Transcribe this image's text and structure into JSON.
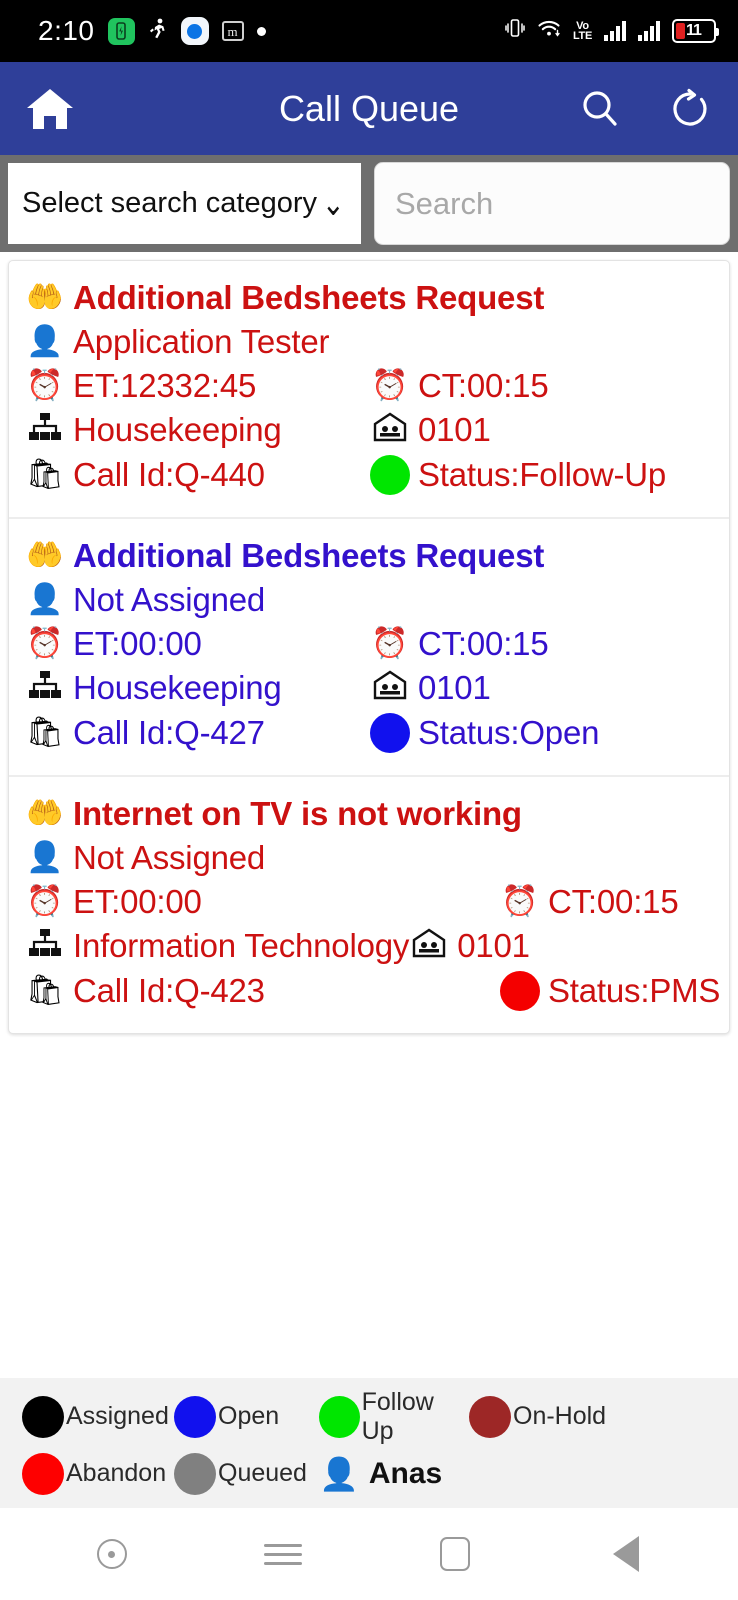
{
  "status_bar": {
    "time": "2:10",
    "left_icons": [
      "battery-saver-icon",
      "running-person-icon",
      "eye-app-icon",
      "m-app-icon",
      "notification-dot-icon"
    ],
    "m_glyph": "m",
    "right_icons": [
      "vibrate-icon",
      "wifi-icon",
      "volte-icon",
      "signal-sim1-icon",
      "signal-sim2-icon",
      "battery-icon"
    ],
    "vibrate_glyph": "❴▯❵",
    "wifi_glyph": "≋",
    "volte_line1": "Vo",
    "volte_line2": "LTE",
    "battery_level": "11",
    "battery_saver_glyph": "🗲"
  },
  "appbar": {
    "home_label": "home-icon",
    "title": "Call Queue",
    "search_label": "search-icon",
    "refresh_label": "refresh-icon"
  },
  "search": {
    "category_label": "Select search category",
    "category_chevron": "⌄",
    "search_placeholder": "Search"
  },
  "labels": {
    "et_prefix": "ET: ",
    "ct_prefix": "CT: ",
    "callid_prefix": "Call Id: ",
    "status_prefix": "Status: "
  },
  "icons": {
    "request": "🤲",
    "person": "👤",
    "clock": "⏰",
    "department": "🏢",
    "room": "🏩",
    "porter": "🛍"
  },
  "colors": {
    "appbar": "#2f3f99",
    "search_bar_bg": "#6e6e6e",
    "card_red": "#cc1111",
    "card_blue": "#3311cc",
    "status_green": "#00e600",
    "status_blue": "#1111ee",
    "status_red": "#f40000",
    "legend_black": "#000000",
    "legend_blue": "#1111ee",
    "legend_green": "#00e600",
    "legend_onhold": "#9d2726",
    "legend_abandon": "#fe0000",
    "legend_queued": "#808080"
  },
  "cards": [
    {
      "title": "Additional Bedsheets Request",
      "assignee": "Application Tester",
      "et": "12332:45",
      "ct": "00:15",
      "department": "Housekeeping",
      "room": "0101",
      "call_id": "Q-440",
      "status": "Follow-Up",
      "text_color": "#cc1111",
      "status_color": "#00e600",
      "wide_left": false
    },
    {
      "title": "Additional Bedsheets Request",
      "assignee": "Not Assigned",
      "et": "00:00",
      "ct": "00:15",
      "department": "Housekeeping",
      "room": "0101",
      "call_id": "Q-427",
      "status": "Open",
      "text_color": "#3311cc",
      "status_color": "#1111ee",
      "wide_left": false
    },
    {
      "title": "Internet on TV is not working",
      "assignee": "Not Assigned",
      "et": "00:00",
      "ct": "00:15",
      "department": "Information Technology",
      "room": "0101",
      "call_id": "Q-423",
      "status": "PMS",
      "text_color": "#cc1111",
      "status_color": "#f40000",
      "wide_left": true
    }
  ],
  "legend": {
    "row1": [
      {
        "label": "Assigned",
        "color": "#000000"
      },
      {
        "label": "Open",
        "color": "#1111ee"
      },
      {
        "label": "Follow Up",
        "color": "#00e600"
      },
      {
        "label": "On-Hold",
        "color": "#9d2726"
      }
    ],
    "row2": [
      {
        "label": "Abandon",
        "color": "#fe0000"
      },
      {
        "label": "Queued",
        "color": "#808080"
      }
    ],
    "user_icon": "👤",
    "user_name": "Anas"
  },
  "navbar": {
    "items": [
      "recent-circle-button",
      "menu-button",
      "home-square-button",
      "back-button"
    ]
  }
}
